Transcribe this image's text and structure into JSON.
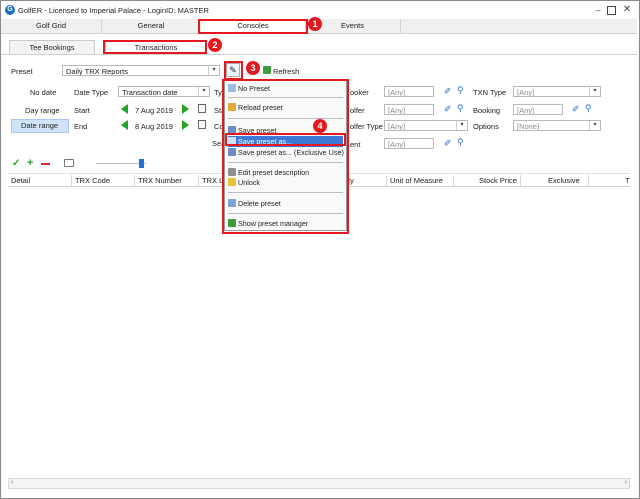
{
  "window": {
    "title": "GolfER - Licensed to Imperial Palace - LoginID: MASTER"
  },
  "main_tabs": [
    {
      "label": "Golf Grid"
    },
    {
      "label": "General"
    },
    {
      "label": "Consoles"
    },
    {
      "label": "Events"
    }
  ],
  "sub_tabs": [
    {
      "label": "Tee Bookings"
    },
    {
      "label": "Transactions"
    }
  ],
  "badges": [
    "1",
    "2",
    "3",
    "4"
  ],
  "filters": {
    "preset_label": "Preset",
    "preset_value": "Daily TRX Reports",
    "refresh_label": "Refresh",
    "no_date_button": "No date",
    "date_type_label": "Date Type",
    "date_type_value": "Transaction date",
    "type_label": "Typ",
    "day_range_button": "Day range",
    "start_label": "Start",
    "start_value": "7 Aug 2019",
    "start2_label": "Star",
    "date_range_button": "Date range",
    "end_label": "End",
    "end_value": "8 Aug 2019",
    "cou_label": "Cou",
    "sea_label": "Sea",
    "booker_label": "ooker",
    "booker_value": "[Any]",
    "golfer_label": "olfer",
    "golfer_value": "[Any]",
    "golfer_type_label": "olfer Type",
    "golfer_type_value": "[Any]",
    "event_label": "ent",
    "event_value": "[Any]",
    "txn_type_label": "TXN Type",
    "txn_type_value": "[Any]",
    "booking_label": "Booking",
    "booking_value": "[Any]",
    "options_label": "Options",
    "options_value": "[None]"
  },
  "grid": {
    "columns": [
      "Detail",
      "TRX Code",
      "TRX Number",
      "TRX Line",
      "ty",
      "Unit of Measure",
      "Stock Price",
      "Exclusive",
      "T"
    ]
  },
  "preset_menu": {
    "items": [
      {
        "label": "No Preset",
        "icon": "page-icon"
      },
      {
        "label": "Reload preset",
        "icon": "reload-icon"
      },
      {
        "label": "Save preset",
        "icon": "save-icon"
      },
      {
        "label": "Save preset as...",
        "icon": "save-as-icon"
      },
      {
        "label": "Save preset as... (Exclusive Use)",
        "icon": "save-as-exclusive-icon"
      },
      {
        "label": "Edit preset description",
        "icon": "edit-icon"
      },
      {
        "label": "Unlock",
        "icon": "unlock-icon"
      },
      {
        "label": "Delete preset",
        "icon": "delete-icon"
      },
      {
        "label": "Show preset manager",
        "icon": "manager-icon"
      }
    ]
  },
  "colors": {
    "highlight": "#e4181f",
    "menu_selection": "#3b78d8",
    "green": "#22a328"
  }
}
